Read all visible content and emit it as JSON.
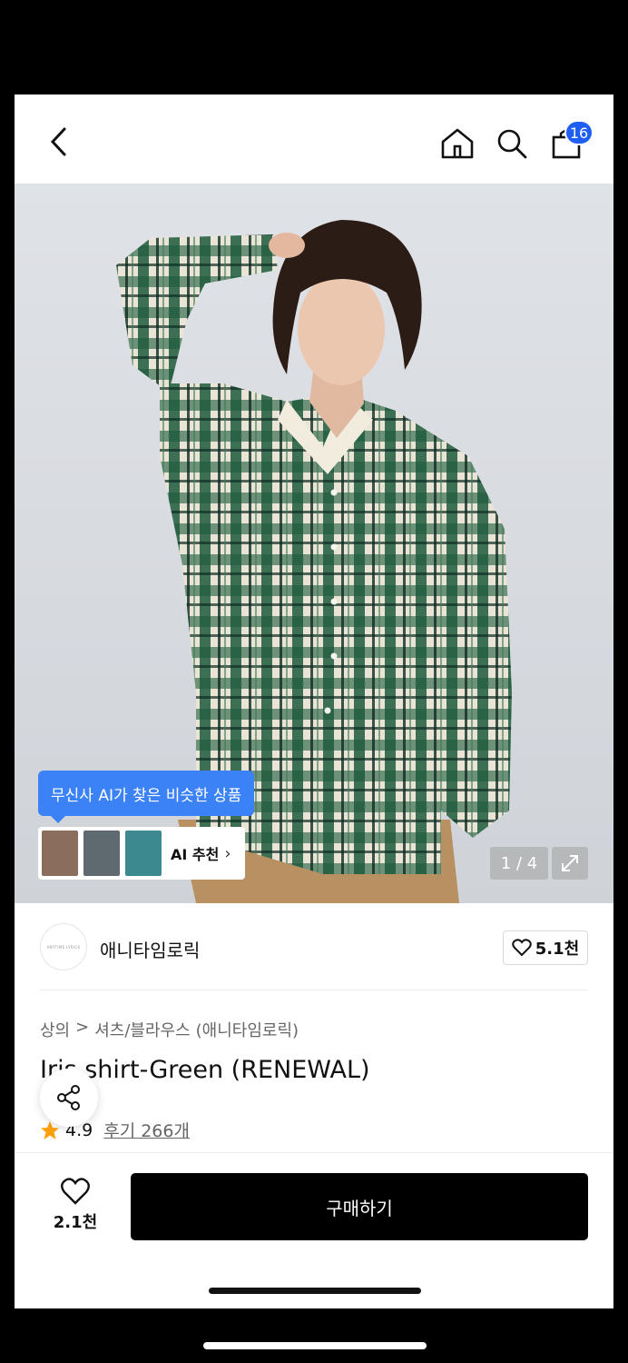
{
  "header": {
    "cart_count": "16"
  },
  "hero": {
    "ai_tip": "무신사 AI가 찾은 비슷한 상품",
    "ai_label": "AI 추천",
    "pager": "1 / 4",
    "thumb_colors": [
      "#8a6d5c",
      "#5e6a6f",
      "#3c8a8f"
    ]
  },
  "brand": {
    "logo_text": "ANYTIME LYRICK",
    "name": "애니타임로릭",
    "likes": "5.1천"
  },
  "product": {
    "breadcrumb": [
      "상의",
      ">",
      "셔츠/블라우스",
      "(애니타임로릭)"
    ],
    "title": "Iris shirt-Green (RENEWAL)",
    "rating": "4.9",
    "reviews": "후기 266개"
  },
  "bottom": {
    "wish_count": "2.1천",
    "buy_label": "구매하기"
  },
  "colors": {
    "accent": "#1f5ef2",
    "tip": "#3b82f6",
    "star": "#ff9f0a"
  }
}
